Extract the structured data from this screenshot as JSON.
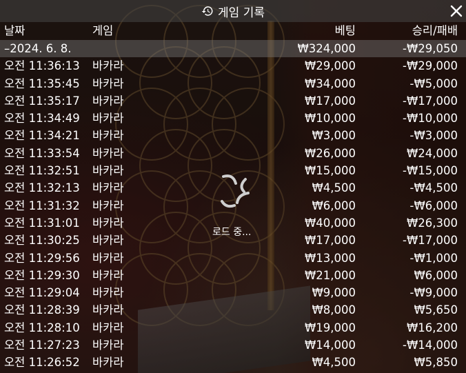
{
  "header": {
    "title": "게임 기록",
    "history_icon": "history-icon",
    "close_icon": "close-icon"
  },
  "columns": {
    "date": "날짜",
    "game": "게임",
    "bet": "베팅",
    "result": "승리/패배"
  },
  "date_group": {
    "label": "–2024. 6. 8.",
    "bet_total": "₩324,000",
    "result_total": "-₩29,050"
  },
  "rows": [
    {
      "time": "오전 11:36:13",
      "game": "바카라",
      "bet": "₩29,000",
      "result": "-₩29,000"
    },
    {
      "time": "오전 11:35:45",
      "game": "바카라",
      "bet": "₩34,000",
      "result": "-₩5,000"
    },
    {
      "time": "오전 11:35:17",
      "game": "바카라",
      "bet": "₩17,000",
      "result": "-₩17,000"
    },
    {
      "time": "오전 11:34:49",
      "game": "바카라",
      "bet": "₩10,000",
      "result": "-₩10,000"
    },
    {
      "time": "오전 11:34:21",
      "game": "바카라",
      "bet": "₩3,000",
      "result": "-₩3,000"
    },
    {
      "time": "오전 11:33:54",
      "game": "바카라",
      "bet": "₩26,000",
      "result": "₩24,000"
    },
    {
      "time": "오전 11:32:51",
      "game": "바카라",
      "bet": "₩15,000",
      "result": "-₩15,000"
    },
    {
      "time": "오전 11:32:13",
      "game": "바카라",
      "bet": "₩4,500",
      "result": "-₩4,500"
    },
    {
      "time": "오전 11:31:32",
      "game": "바카라",
      "bet": "₩6,000",
      "result": "-₩6,000"
    },
    {
      "time": "오전 11:31:01",
      "game": "바카라",
      "bet": "₩40,000",
      "result": "₩26,300"
    },
    {
      "time": "오전 11:30:25",
      "game": "바카라",
      "bet": "₩17,000",
      "result": "-₩17,000"
    },
    {
      "time": "오전 11:29:56",
      "game": "바카라",
      "bet": "₩13,000",
      "result": "-₩1,000"
    },
    {
      "time": "오전 11:29:30",
      "game": "바카라",
      "bet": "₩21,000",
      "result": "₩6,000"
    },
    {
      "time": "오전 11:29:04",
      "game": "바카라",
      "bet": "₩9,000",
      "result": "-₩9,000"
    },
    {
      "time": "오전 11:28:39",
      "game": "바카라",
      "bet": "₩8,000",
      "result": "₩5,650"
    },
    {
      "time": "오전 11:28:10",
      "game": "바카라",
      "bet": "₩19,000",
      "result": "₩16,200"
    },
    {
      "time": "오전 11:27:23",
      "game": "바카라",
      "bet": "₩14,000",
      "result": "-₩14,000"
    },
    {
      "time": "오전 11:26:52",
      "game": "바카라",
      "bet": "₩4,500",
      "result": "₩5,850"
    }
  ],
  "loading": {
    "text": "로드 중...",
    "spinner_icon": "loading-spinner-icon"
  },
  "colors": {
    "text": "#ffffff",
    "header_bg": "#464646",
    "date_row_bg": "#787878"
  }
}
